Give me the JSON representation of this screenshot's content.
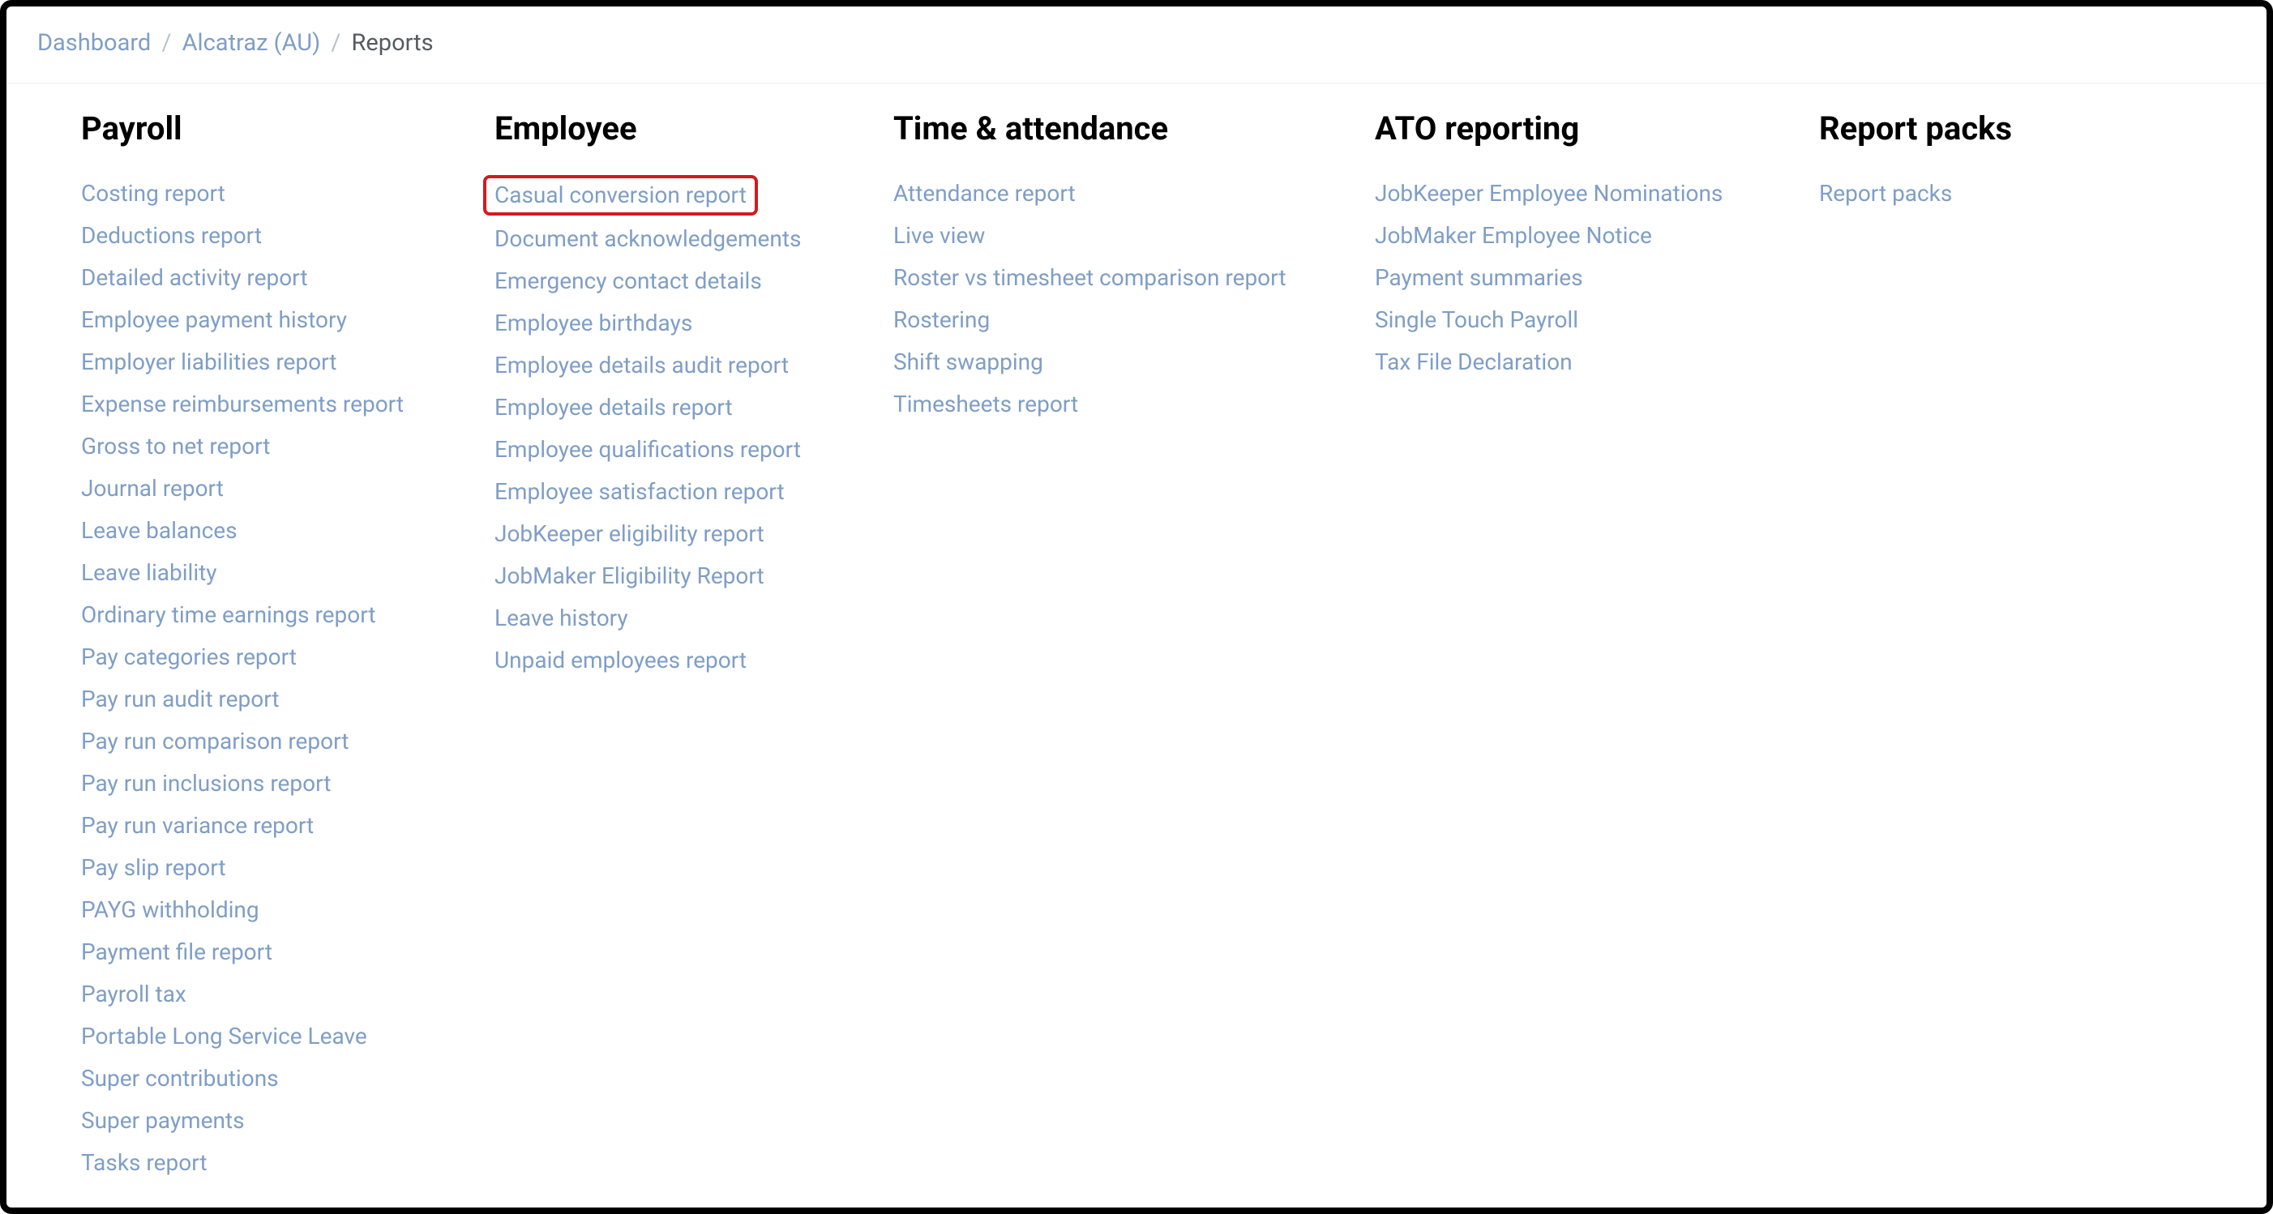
{
  "breadcrumb": {
    "dashboard": "Dashboard",
    "org": "Alcatraz (AU)",
    "current": "Reports"
  },
  "columns": [
    {
      "key": "payroll",
      "heading": "Payroll",
      "items": [
        {
          "label": "Costing report"
        },
        {
          "label": "Deductions report"
        },
        {
          "label": "Detailed activity report"
        },
        {
          "label": "Employee payment history"
        },
        {
          "label": "Employer liabilities report"
        },
        {
          "label": "Expense reimbursements report"
        },
        {
          "label": "Gross to net report"
        },
        {
          "label": "Journal report"
        },
        {
          "label": "Leave balances"
        },
        {
          "label": "Leave liability"
        },
        {
          "label": "Ordinary time earnings report"
        },
        {
          "label": "Pay categories report"
        },
        {
          "label": "Pay run audit report"
        },
        {
          "label": "Pay run comparison report"
        },
        {
          "label": "Pay run inclusions report"
        },
        {
          "label": "Pay run variance report"
        },
        {
          "label": "Pay slip report"
        },
        {
          "label": "PAYG withholding"
        },
        {
          "label": "Payment file report"
        },
        {
          "label": "Payroll tax"
        },
        {
          "label": "Portable Long Service Leave"
        },
        {
          "label": "Super contributions"
        },
        {
          "label": "Super payments"
        },
        {
          "label": "Tasks report"
        }
      ]
    },
    {
      "key": "employee",
      "heading": "Employee",
      "items": [
        {
          "label": "Casual conversion report",
          "highlighted": true
        },
        {
          "label": "Document acknowledgements"
        },
        {
          "label": "Emergency contact details"
        },
        {
          "label": "Employee birthdays"
        },
        {
          "label": "Employee details audit report"
        },
        {
          "label": "Employee details report"
        },
        {
          "label": "Employee qualifications report"
        },
        {
          "label": "Employee satisfaction report"
        },
        {
          "label": "JobKeeper eligibility report"
        },
        {
          "label": "JobMaker Eligibility Report"
        },
        {
          "label": "Leave history"
        },
        {
          "label": "Unpaid employees report"
        }
      ]
    },
    {
      "key": "time",
      "heading": "Time & attendance",
      "items": [
        {
          "label": "Attendance report"
        },
        {
          "label": "Live view"
        },
        {
          "label": "Roster vs timesheet comparison report"
        },
        {
          "label": "Rostering"
        },
        {
          "label": "Shift swapping"
        },
        {
          "label": "Timesheets report"
        }
      ]
    },
    {
      "key": "ato",
      "heading": "ATO reporting",
      "items": [
        {
          "label": "JobKeeper Employee Nominations"
        },
        {
          "label": "JobMaker Employee Notice"
        },
        {
          "label": "Payment summaries"
        },
        {
          "label": "Single Touch Payroll"
        },
        {
          "label": "Tax File Declaration"
        }
      ]
    },
    {
      "key": "packs",
      "heading": "Report packs",
      "items": [
        {
          "label": "Report packs"
        }
      ]
    }
  ]
}
